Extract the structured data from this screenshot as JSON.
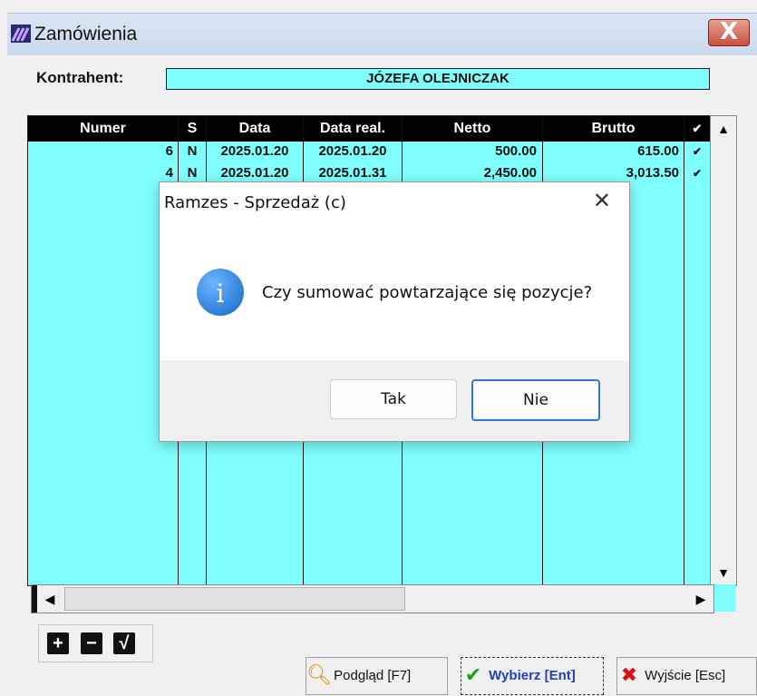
{
  "window": {
    "title": "Zamówienia",
    "close_glyph": "X"
  },
  "kontrahent": {
    "label": "Kontrahent:",
    "value": "JÓZEFA OLEJNICZAK"
  },
  "table": {
    "columns": [
      "Numer",
      "S",
      "Data",
      "Data real.",
      "Netto",
      "Brutto",
      "✔"
    ],
    "rows": [
      [
        "6",
        "N",
        "2025.01.20",
        "2025.01.20",
        "500.00",
        "615.00",
        "✔"
      ],
      [
        "4",
        "N",
        "2025.01.20",
        "2025.01.31",
        "2,450.00",
        "3,013.50",
        "✔"
      ]
    ]
  },
  "toolbar": {
    "add": "+",
    "remove": "−",
    "confirm": "√"
  },
  "buttons": {
    "preview": "Podgląd  [F7]",
    "select": "Wybierz  [Ent]",
    "exit": "Wyjście [Esc]"
  },
  "icons": {
    "preview": "magnifier-icon",
    "select": "checkmark-icon",
    "exit": "red-x-icon"
  },
  "colors": {
    "grid_bg": "#80ffff",
    "header_bg": "#000000",
    "select_text": "#1f3fbf",
    "exit_icon": "#e01010"
  },
  "dialog": {
    "title": "Ramzes - Sprzedaż (c)",
    "message": "Czy sumować powtarzające się pozycje?",
    "yes": "Tak",
    "no": "Nie",
    "icon_glyph": "i"
  }
}
